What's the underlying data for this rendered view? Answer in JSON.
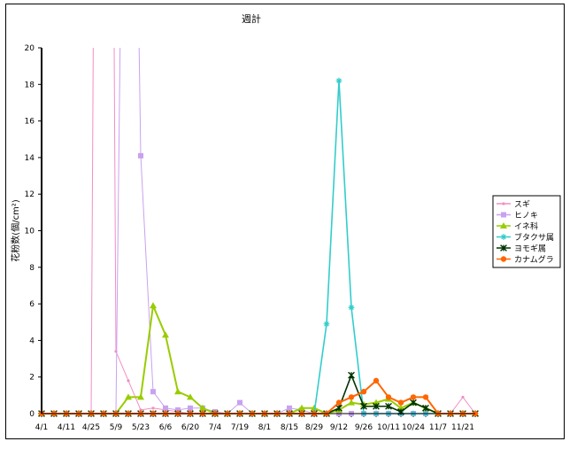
{
  "chart_data": {
    "type": "line",
    "title": "週計",
    "xlabel": "",
    "ylabel": "花粉数(個/cm²)",
    "ylim": [
      0,
      20
    ],
    "yticks": [
      0,
      2,
      4,
      6,
      8,
      10,
      12,
      14,
      16,
      18,
      20
    ],
    "grid": false,
    "legend_position": "right",
    "categories": [
      "4/1",
      "4/11",
      "4/25",
      "5/9",
      "5/23",
      "6/6",
      "6/20",
      "7/4",
      "7/19",
      "8/1",
      "8/15",
      "8/29",
      "9/12",
      "9/26",
      "10/11",
      "10/24",
      "11/7",
      "11/21"
    ],
    "n_points": 36,
    "label_every": 2,
    "series": [
      {
        "name": "スギ",
        "color": "#f28ec4",
        "marker": "dot",
        "values": [
          0,
          0,
          0,
          0,
          0,
          120,
          3.4,
          1.8,
          0.2,
          0.3,
          0.2,
          0.1,
          0,
          0,
          0,
          0,
          0,
          0,
          0,
          0,
          0,
          0,
          0,
          0,
          0,
          0,
          0,
          0,
          0,
          0,
          0,
          0,
          0,
          0,
          0.9,
          0
        ]
      },
      {
        "name": "ヒノキ",
        "color": "#c8a2f0",
        "marker": "square",
        "values": [
          0,
          0,
          0,
          0,
          0,
          0,
          0,
          60,
          14.1,
          1.2,
          0.3,
          0.2,
          0.3,
          0.3,
          0.1,
          0,
          0.6,
          0,
          0,
          0,
          0.3,
          0.2,
          0,
          0,
          0,
          0,
          0,
          0,
          0,
          0,
          0,
          0,
          0,
          0,
          0,
          0
        ]
      },
      {
        "name": "イネ科",
        "color": "#99cc00",
        "marker": "triangle",
        "values": [
          0,
          0,
          0,
          0,
          0,
          0,
          0,
          0.9,
          0.9,
          5.9,
          4.3,
          1.2,
          0.9,
          0.3,
          0,
          0,
          0,
          0,
          0,
          0,
          0,
          0.3,
          0.3,
          0,
          0.2,
          0.6,
          0.5,
          0.6,
          0.8,
          0.3,
          0.6,
          0.3,
          0,
          0,
          0,
          0
        ]
      },
      {
        "name": "ブタクサ属",
        "color": "#33cccc",
        "marker": "asterisk",
        "values": [
          0,
          0,
          0,
          0,
          0,
          0,
          0,
          0,
          0,
          0,
          0,
          0,
          0,
          0,
          0,
          0,
          0,
          0,
          0,
          0,
          0,
          0,
          0,
          4.9,
          18.2,
          5.8,
          0,
          0,
          0,
          0,
          0,
          0,
          0,
          0,
          0,
          0
        ]
      },
      {
        "name": "ヨモギ属",
        "color": "#003300",
        "marker": "x",
        "values": [
          0,
          0,
          0,
          0,
          0,
          0,
          0,
          0,
          0,
          0,
          0,
          0,
          0,
          0,
          0,
          0,
          0,
          0,
          0,
          0,
          0,
          0,
          0,
          0,
          0.3,
          2.1,
          0.4,
          0.4,
          0.4,
          0.1,
          0.6,
          0.3,
          0,
          0,
          0,
          0
        ]
      },
      {
        "name": "カナムグラ",
        "color": "#ff6600",
        "marker": "diamond",
        "values": [
          0,
          0,
          0,
          0,
          0,
          0,
          0,
          0,
          0,
          0,
          0,
          0,
          0,
          0,
          0,
          0,
          0,
          0,
          0,
          0,
          0,
          0,
          0,
          0,
          0.6,
          0.9,
          1.2,
          1.8,
          0.9,
          0.6,
          0.9,
          0.9,
          0,
          0,
          0,
          0
        ]
      }
    ]
  }
}
